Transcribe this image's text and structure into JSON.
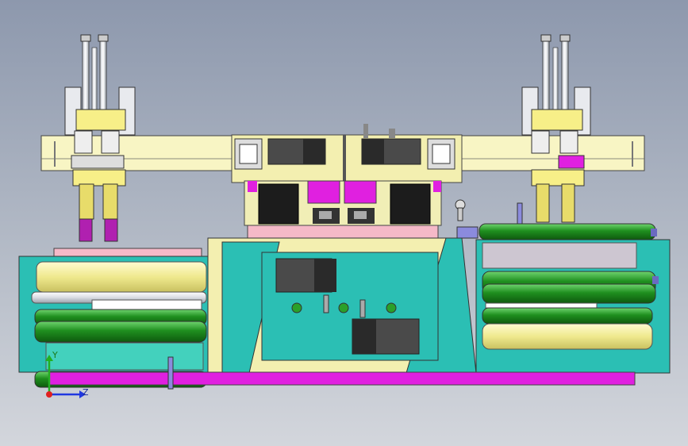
{
  "view": {
    "background_top": "#8d98ad",
    "background_bottom": "#d3d6dc"
  },
  "triad": {
    "y_label": "Y",
    "z_label": "Z",
    "x_color": "#e02020",
    "y_color": "#22b022",
    "z_color": "#2038e0"
  },
  "colors": {
    "yellow_plate": "#f7f4b8",
    "teal_body": "#2bbfb4",
    "teal_dark": "#1a8f88",
    "magenta": "#e020e0",
    "green_roller": "#2a9a2a",
    "yellow_roller": "#f2ee9a",
    "motor_grey": "#4a4a4a",
    "pink_plate": "#f5b9c8",
    "cream_panel": "#f3efb0"
  },
  "parts": [
    "left-valve-assembly",
    "right-valve-assembly",
    "top-crossbar",
    "center-drive-unit",
    "left-roller-stack",
    "right-roller-stack",
    "center-gear-box",
    "base-plate"
  ]
}
